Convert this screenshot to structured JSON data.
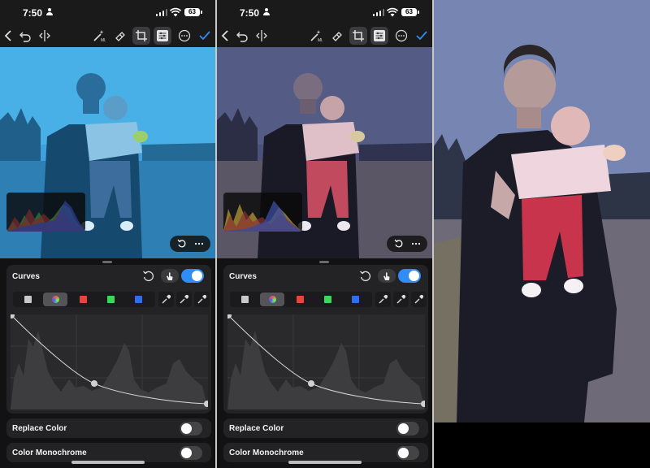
{
  "left_screen": {
    "status": {
      "time": "7:50",
      "battery": "63"
    },
    "panel": {
      "curves_title": "Curves",
      "curves_enabled": true,
      "rows": [
        {
          "label": "Replace Color",
          "enabled": false
        },
        {
          "label": "Color Monochrome",
          "enabled": false
        }
      ]
    },
    "tint": "#3f9bd6"
  },
  "middle_screen": {
    "status": {
      "time": "7:50",
      "battery": "63"
    },
    "panel": {
      "curves_title": "Curves",
      "curves_enabled": true,
      "rows": [
        {
          "label": "Replace Color",
          "enabled": false
        },
        {
          "label": "Color Monochrome",
          "enabled": false
        }
      ]
    },
    "tint": "#4a4f6e"
  },
  "toolbar_icons": [
    "back-chevron-icon",
    "undo-icon",
    "compare-icon",
    "magic-wand-icon",
    "eraser-icon",
    "crop-icon",
    "adjustments-icon",
    "more-icon",
    "checkmark-icon"
  ],
  "channels": [
    "white",
    "rgb",
    "red",
    "green",
    "blue"
  ],
  "channel_colors": {
    "white": "#c8c8c8",
    "red": "#e5453a",
    "green": "#3ed65a",
    "blue": "#2e6ef0",
    "accent": "#2f8df5"
  },
  "droppers": [
    "black-point-dropper-icon",
    "gray-point-dropper-icon",
    "white-point-dropper-icon"
  ],
  "curve_points_normalized_io": [
    [
      0,
      1
    ],
    [
      0.42,
      0.2
    ],
    [
      1,
      0
    ]
  ]
}
